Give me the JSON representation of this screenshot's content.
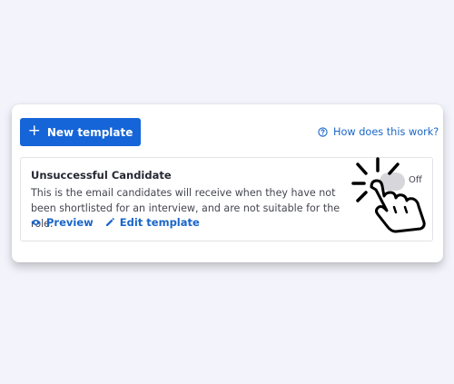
{
  "toolbar": {
    "new_template_label": "New template",
    "help_link_label": "How does this work?"
  },
  "template": {
    "title": "Unsuccessful Candidate",
    "description": "This is the email candidates will receive when they have not been shortlisted for an interview, and are not suitable for the role.",
    "preview_label": "Preview",
    "edit_label": "Edit template",
    "toggle_state_label": "Off"
  },
  "icons": {
    "plus": "plus-icon",
    "help": "question-circle-icon",
    "preview": "eye-icon",
    "edit": "pencil-icon",
    "pointer": "hand-pointer-click-icon"
  },
  "colors": {
    "accent": "#1565d8",
    "link": "#1a66c9",
    "background": "#f3f3fb"
  }
}
